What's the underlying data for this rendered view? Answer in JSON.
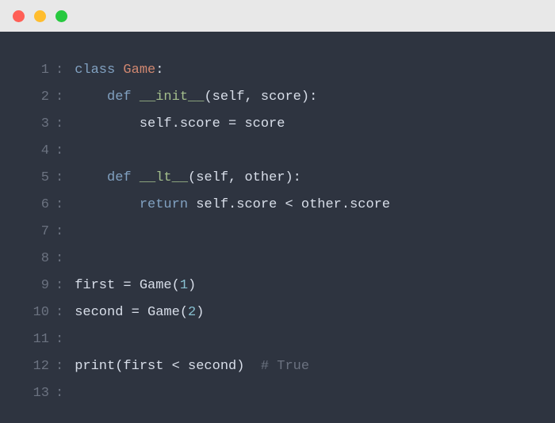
{
  "window": {
    "traffic_lights": [
      "red",
      "yellow",
      "green"
    ]
  },
  "editor": {
    "lines": [
      {
        "num": "1",
        "tokens": [
          {
            "cls": "tok-keyword",
            "t": "class"
          },
          {
            "cls": "",
            "t": " "
          },
          {
            "cls": "tok-class",
            "t": "Game"
          },
          {
            "cls": "",
            "t": ":"
          }
        ]
      },
      {
        "num": "2",
        "tokens": [
          {
            "cls": "",
            "t": "    "
          },
          {
            "cls": "tok-keyword",
            "t": "def"
          },
          {
            "cls": "",
            "t": " "
          },
          {
            "cls": "tok-dunder",
            "t": "__init__"
          },
          {
            "cls": "",
            "t": "(self, score):"
          }
        ]
      },
      {
        "num": "3",
        "tokens": [
          {
            "cls": "",
            "t": "        self.score = score"
          }
        ]
      },
      {
        "num": "4",
        "tokens": []
      },
      {
        "num": "5",
        "tokens": [
          {
            "cls": "",
            "t": "    "
          },
          {
            "cls": "tok-keyword",
            "t": "def"
          },
          {
            "cls": "",
            "t": " "
          },
          {
            "cls": "tok-dunder",
            "t": "__lt__"
          },
          {
            "cls": "",
            "t": "(self, other):"
          }
        ]
      },
      {
        "num": "6",
        "tokens": [
          {
            "cls": "",
            "t": "        "
          },
          {
            "cls": "tok-keyword",
            "t": "return"
          },
          {
            "cls": "",
            "t": " self.score < other.score"
          }
        ]
      },
      {
        "num": "7",
        "tokens": []
      },
      {
        "num": "8",
        "tokens": []
      },
      {
        "num": "9",
        "tokens": [
          {
            "cls": "",
            "t": "first = Game("
          },
          {
            "cls": "tok-number",
            "t": "1"
          },
          {
            "cls": "",
            "t": ")"
          }
        ]
      },
      {
        "num": "10",
        "tokens": [
          {
            "cls": "",
            "t": "second = Game("
          },
          {
            "cls": "tok-number",
            "t": "2"
          },
          {
            "cls": "",
            "t": ")"
          }
        ]
      },
      {
        "num": "11",
        "tokens": []
      },
      {
        "num": "12",
        "tokens": [
          {
            "cls": "",
            "t": "print(first < second)  "
          },
          {
            "cls": "tok-comment",
            "t": "# True"
          }
        ]
      },
      {
        "num": "13",
        "tokens": []
      }
    ]
  }
}
